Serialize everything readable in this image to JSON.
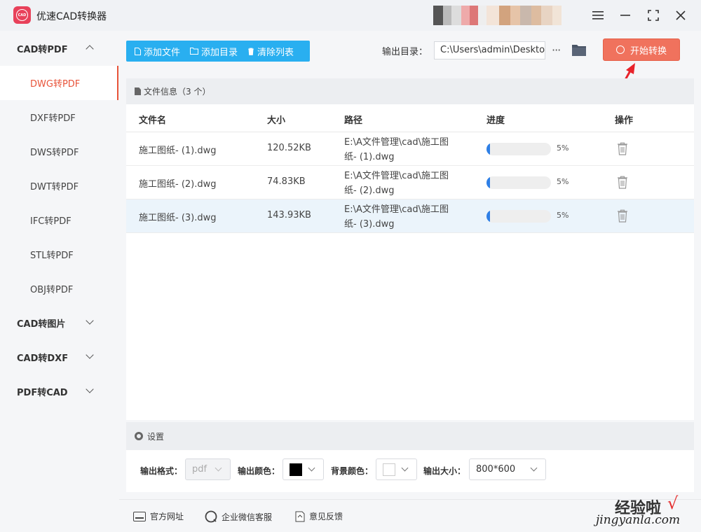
{
  "app": {
    "title": "优速CAD转换器",
    "logo_text": "CAD"
  },
  "window_controls": [
    "menu-icon",
    "minimize-icon",
    "maximize-icon",
    "close-icon"
  ],
  "sidebar": {
    "groups": [
      {
        "label": "CAD转PDF",
        "expanded": true,
        "items": [
          {
            "label": "DWG转PDF",
            "active": true
          },
          {
            "label": "DXF转PDF"
          },
          {
            "label": "DWS转PDF"
          },
          {
            "label": "DWT转PDF"
          },
          {
            "label": "IFC转PDF"
          },
          {
            "label": "STL转PDF"
          },
          {
            "label": "OBJ转PDF"
          }
        ]
      },
      {
        "label": "CAD转图片",
        "expanded": false
      },
      {
        "label": "CAD转DXF",
        "expanded": false
      },
      {
        "label": "PDF转CAD",
        "expanded": false
      }
    ]
  },
  "toolbar": {
    "add_file": "添加文件",
    "add_dir": "添加目录",
    "clear_list": "清除列表",
    "output_label": "输出目录：",
    "output_path": "C:\\Users\\admin\\Desktop",
    "more": "···",
    "start": "开始转换"
  },
  "file_panel": {
    "header": "文件信息（3 个）",
    "columns": [
      "文件名",
      "大小",
      "路径",
      "进度",
      "操作"
    ],
    "rows": [
      {
        "name": "施工图纸- (1).dwg",
        "size": "120.52KB",
        "path_line1": "E:\\A文件管理\\cad\\施工图",
        "path_line2": "纸- (1).dwg",
        "progress": "5%",
        "progress_value": 0.05,
        "selected": false
      },
      {
        "name": "施工图纸- (2).dwg",
        "size": "74.83KB",
        "path_line1": "E:\\A文件管理\\cad\\施工图",
        "path_line2": "纸- (2).dwg",
        "progress": "5%",
        "progress_value": 0.05,
        "selected": false
      },
      {
        "name": "施工图纸- (3).dwg",
        "size": "143.93KB",
        "path_line1": "E:\\A文件管理\\cad\\施工图",
        "path_line2": "纸- (3).dwg",
        "progress": "5%",
        "progress_value": 0.05,
        "selected": true
      }
    ]
  },
  "settings": {
    "title": "设置",
    "format_label": "输出格式：",
    "format_value": "pdf",
    "color_label": "输出颜色：",
    "color_value": "#000000",
    "bg_label": "背景颜色：",
    "bg_value": "#ffffff",
    "size_label": "输出大小：",
    "size_value": "800*600"
  },
  "footer": {
    "website": "官方网址",
    "wechat": "企业微信客服",
    "feedback": "意见反馈"
  },
  "watermark": {
    "title": "经验啦",
    "subtitle": "jingyanla.com",
    "check": "√"
  },
  "colors": {
    "accent": "#e8543a",
    "toolbar": "#29aff0",
    "start": "#f0725d",
    "progress": "#2e7fe6"
  }
}
